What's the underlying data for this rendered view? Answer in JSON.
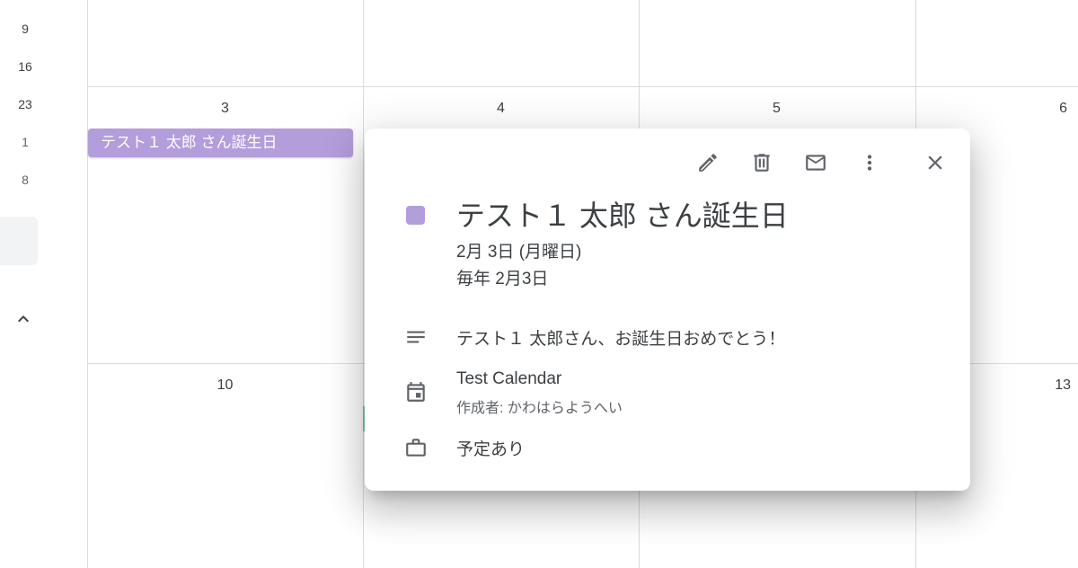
{
  "mini_calendar": {
    "numbers": [
      "9",
      "16",
      "23",
      "1",
      "8"
    ],
    "collapse_icon": "chevron-up-icon"
  },
  "grid": {
    "week1": [
      "3",
      "4",
      "5",
      "6"
    ],
    "week2": [
      "10",
      "13"
    ]
  },
  "event_chip": {
    "label": "テスト１ 太郎 さん誕生日",
    "color": "#b39ddb"
  },
  "popover": {
    "toolbar": {
      "edit_icon": "pencil-icon",
      "delete_icon": "trash-icon",
      "email_icon": "mail-icon",
      "more_icon": "more-vert-icon",
      "close_icon": "close-icon"
    },
    "title": "テスト１ 太郎 さん誕生日",
    "date": "2月 3日 (月曜日)",
    "recurrence": "毎年 2月3日",
    "description": "テスト１ 太郎さん、お誕生日おめでとう！",
    "calendar_name": "Test Calendar",
    "creator": "作成者: かわはらようへい",
    "availability": "予定あり",
    "event_color": "#b39ddb"
  }
}
